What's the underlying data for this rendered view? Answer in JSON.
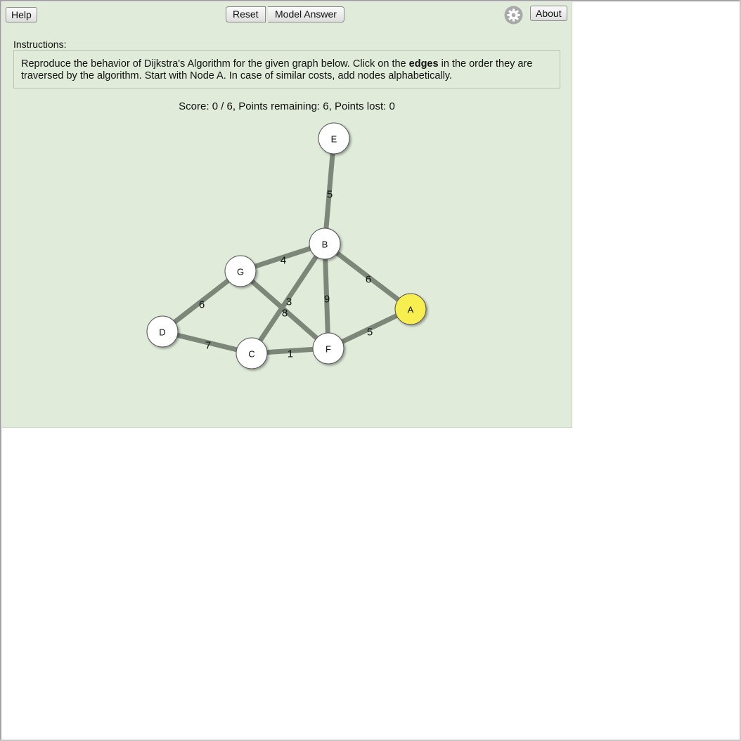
{
  "toolbar": {
    "help_label": "Help",
    "reset_label": "Reset",
    "model_answer_label": "Model Answer",
    "about_label": "About",
    "settings_icon": "gear-icon"
  },
  "instructions": {
    "label": "Instructions:",
    "text_before": "Reproduce the behavior of Dijkstra's Algorithm for the given graph below. Click on the ",
    "emphasis": "edges",
    "text_after": " in the order they are traversed by the algorithm. Start with Node A. In case of similar costs, add nodes alphabetically."
  },
  "score": {
    "text": "Score: 0 / 6, Points remaining: 6, Points lost: 0"
  },
  "graph": {
    "start_node": "A",
    "highlight_color": "#f7ee4f",
    "nodes": [
      "A",
      "B",
      "C",
      "D",
      "E",
      "F",
      "G"
    ],
    "edges": [
      {
        "from": "E",
        "to": "B",
        "weight": "5"
      },
      {
        "from": "B",
        "to": "G",
        "weight": "4"
      },
      {
        "from": "B",
        "to": "A",
        "weight": "6"
      },
      {
        "from": "B",
        "to": "F",
        "weight": "9"
      },
      {
        "from": "B",
        "to": "C",
        "weight": "3"
      },
      {
        "from": "G",
        "to": "F",
        "weight": "8"
      },
      {
        "from": "G",
        "to": "D",
        "weight": "6"
      },
      {
        "from": "D",
        "to": "C",
        "weight": "7"
      },
      {
        "from": "C",
        "to": "F",
        "weight": "1"
      },
      {
        "from": "F",
        "to": "A",
        "weight": "5"
      }
    ]
  }
}
